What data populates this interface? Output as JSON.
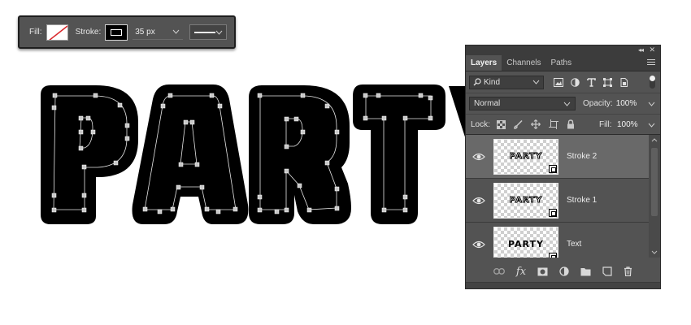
{
  "options_bar": {
    "fill_label": "Fill:",
    "stroke_label": "Stroke:",
    "stroke_size": "35 px"
  },
  "artwork": {
    "visible_text": "PART"
  },
  "layers_panel": {
    "tabs": [
      {
        "label": "Layers",
        "active": true
      },
      {
        "label": "Channels",
        "active": false
      },
      {
        "label": "Paths",
        "active": false
      }
    ],
    "filter": {
      "kind_label": "Kind"
    },
    "blend_mode": "Normal",
    "opacity_label": "Opacity:",
    "opacity_value": "100%",
    "lock_label": "Lock:",
    "fill_label": "Fill:",
    "fill_value": "100%",
    "layers": [
      {
        "name": "Stroke 2",
        "thumb_text": "PARTY",
        "selected": true,
        "style": "outline"
      },
      {
        "name": "Stroke 1",
        "thumb_text": "PARTY",
        "selected": false,
        "style": "outline"
      },
      {
        "name": "Text",
        "thumb_text": "PARTY",
        "selected": false,
        "style": "solid"
      }
    ],
    "footer_fx_label": "fx"
  },
  "colors": {
    "panel_bg": "#535353",
    "selected_row": "#696969",
    "dark_bar": "#3c3c3c",
    "artwork_fill": "#000000",
    "anchor_point": "#c8c8c8"
  }
}
